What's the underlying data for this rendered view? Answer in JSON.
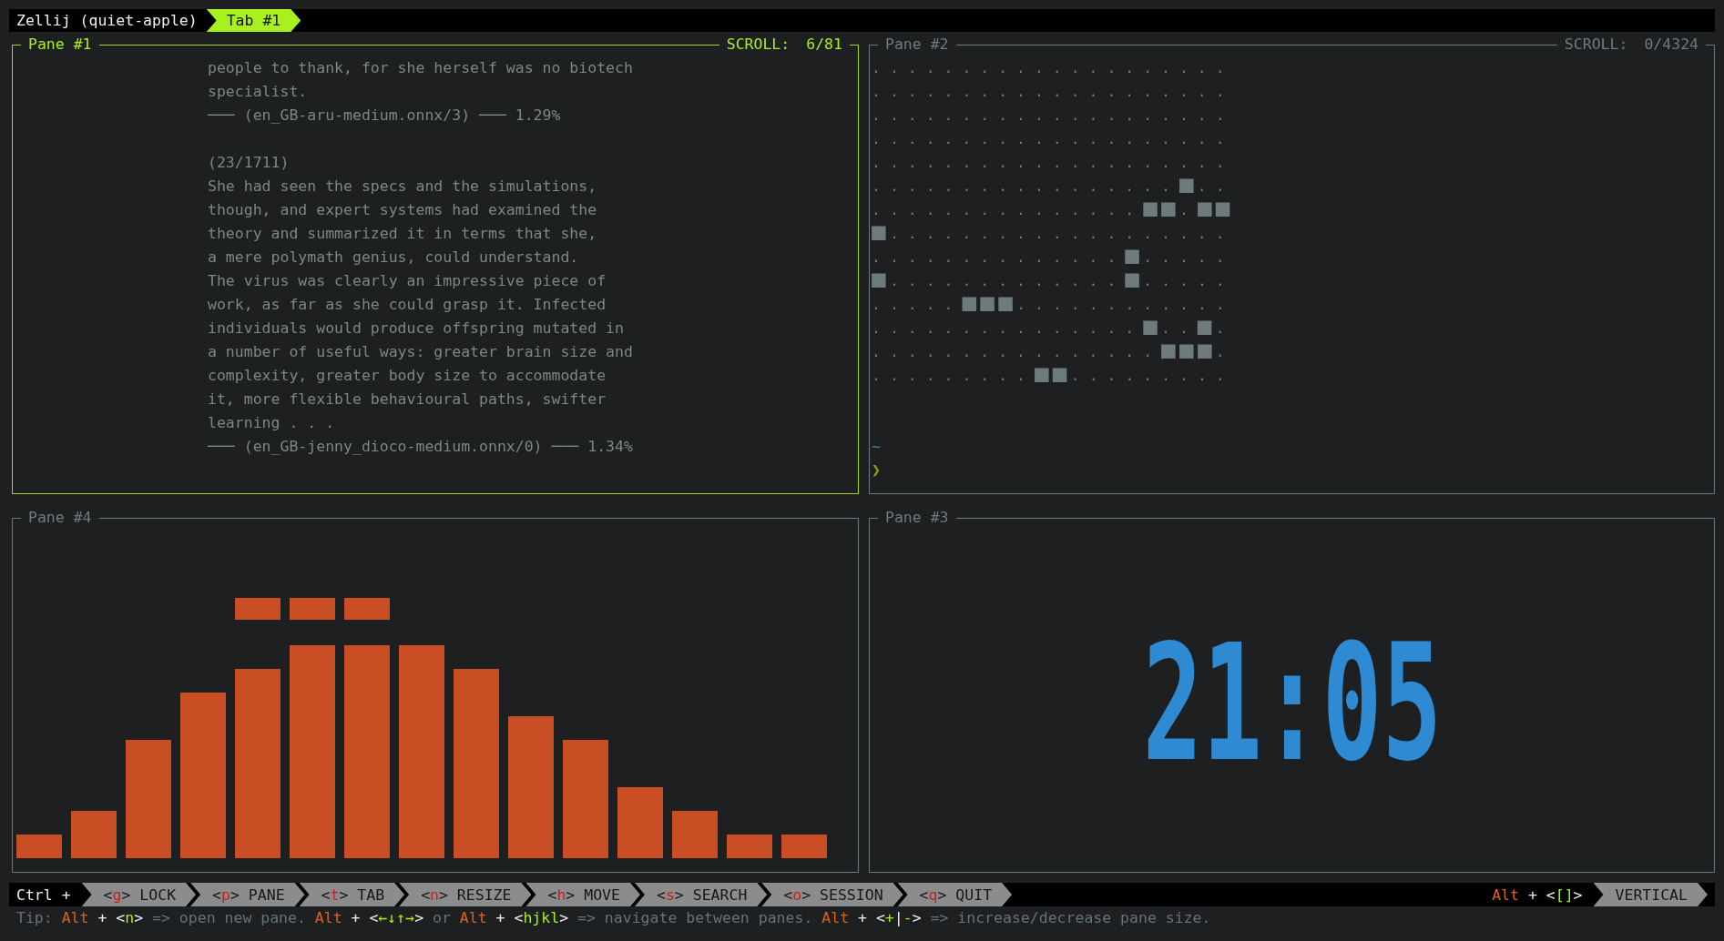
{
  "session": {
    "name": "Zellij (quiet-apple)",
    "tabs": [
      {
        "label": "Tab #1",
        "selected": true
      }
    ]
  },
  "panes": [
    {
      "title": "Pane #1",
      "focused": true,
      "scroll_label": "SCROLL:",
      "scroll": "6/81",
      "kind": "reader",
      "blocks": [
        {
          "lines": [
            "people to thank, for she herself was no biotech",
            "specialist."
          ],
          "caption": "─── (en_GB-aru-medium.onnx/3) ─── 1.29%"
        },
        {
          "counter": "(23/1711)",
          "lines": [
            "She had seen the specs and the simulations,",
            "though, and expert systems had examined the",
            "theory and summarized it in terms that she,",
            "a mere polymath genius, could understand.",
            "The virus was clearly an impressive piece of",
            "work, as far as she could grasp it. Infected",
            "individuals would produce offspring mutated in",
            "a number of useful ways: greater brain size and",
            "complexity, greater body size to accommodate",
            "it, more flexible behavioural paths, swifter",
            "learning . . ."
          ],
          "caption": "─── (en_GB-jenny_dioco-medium.onnx/0) ─── 1.34%"
        }
      ]
    },
    {
      "title": "Pane #2",
      "focused": false,
      "scroll_label": "SCROLL:",
      "scroll": "0/4324",
      "kind": "grid",
      "rows": [
        ". . . . . . . . . . . . . . . . . . . .",
        ". . . . . . . . . . . . . . . . . . . .",
        ". . . . . . . . . . . . . . . . . . . .",
        ". . . . . . . . . . . . . . . . . . . .",
        ". . . . . . . . . . . . . . . . . . . .",
        ". . . . . . . . . . . . . . . . . ■ . .",
        ". . . . . . . . . . . . . . . ■ ■ . ■ ■",
        "■ . . . . . . . . . . . . . . . . . . .",
        ". . . . . . . . . . . . . . ■ . . . . .",
        "■ . . . . . . . . . . . . . ■ . . . . .",
        ". . . . . ■ ■ ■ . . . . . . . . . . . .",
        ". . . . . . . . . . . . . . . ■ . . ■ .",
        ". . . . . . . . . . . . . . . . ■ ■ ■ .",
        ". . . . . . . . . ■ ■ . . . . . . . . ."
      ],
      "cwd": "~",
      "prompt": "❯"
    },
    {
      "title": "Pane #4",
      "focused": false,
      "kind": "visualizer"
    },
    {
      "title": "Pane #3",
      "focused": false,
      "kind": "clock",
      "time": "21:05"
    }
  ],
  "keybar": {
    "modifier": "Ctrl +",
    "modes": [
      {
        "open": "<",
        "key": "g",
        "close": ">",
        "action": "LOCK"
      },
      {
        "open": "<",
        "key": "p",
        "close": ">",
        "action": "PANE"
      },
      {
        "open": "<",
        "key": "t",
        "close": ">",
        "action": "TAB"
      },
      {
        "open": "<",
        "key": "n",
        "close": ">",
        "action": "RESIZE"
      },
      {
        "open": "<",
        "key": "h",
        "close": ">",
        "action": "MOVE"
      },
      {
        "open": "<",
        "key": "s",
        "close": ">",
        "action": "SEARCH"
      },
      {
        "open": "<",
        "key": "o",
        "close": ">",
        "action": "SESSION"
      },
      {
        "open": "<",
        "key": "q",
        "close": ">",
        "action": "QUIT"
      }
    ],
    "layout_hint": [
      {
        "text": "Alt",
        "kind": "mod"
      },
      {
        "text": " + <",
        "kind": "plain"
      },
      {
        "text": "[]",
        "kind": "key"
      },
      {
        "text": ">",
        "kind": "plain"
      }
    ],
    "layout_action": "VERTICAL"
  },
  "tip": [
    {
      "text": "Tip: ",
      "kind": "muted"
    },
    {
      "text": "Alt",
      "kind": "mod"
    },
    {
      "text": " + <",
      "kind": "plain"
    },
    {
      "text": "n",
      "kind": "key"
    },
    {
      "text": ">",
      "kind": "plain"
    },
    {
      "text": " => open new pane. ",
      "kind": "muted"
    },
    {
      "text": "Alt",
      "kind": "mod"
    },
    {
      "text": " + <",
      "kind": "plain"
    },
    {
      "text": "←↓↑→",
      "kind": "key"
    },
    {
      "text": ">",
      "kind": "plain"
    },
    {
      "text": " or ",
      "kind": "muted"
    },
    {
      "text": "Alt",
      "kind": "mod"
    },
    {
      "text": " + <",
      "kind": "plain"
    },
    {
      "text": "hjkl",
      "kind": "key"
    },
    {
      "text": ">",
      "kind": "plain"
    },
    {
      "text": " => navigate between panes. ",
      "kind": "muted"
    },
    {
      "text": "Alt",
      "kind": "mod"
    },
    {
      "text": " + <",
      "kind": "plain"
    },
    {
      "text": "+",
      "kind": "key"
    },
    {
      "text": "|",
      "kind": "plain"
    },
    {
      "text": "-",
      "kind": "key"
    },
    {
      "text": ">",
      "kind": "plain"
    },
    {
      "text": " => increase/decrease pane size.",
      "kind": "muted"
    }
  ]
}
